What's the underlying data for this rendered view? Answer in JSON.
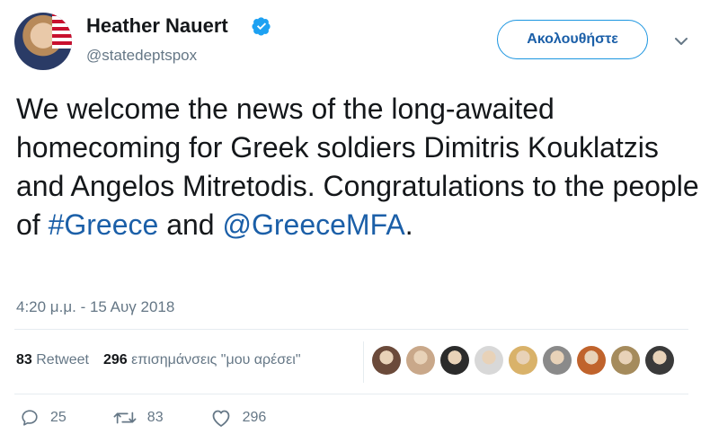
{
  "author": {
    "name": "Heather Nauert",
    "handle": "@statedeptspox",
    "verified": true
  },
  "follow_button": {
    "label": "Ακολουθήστε"
  },
  "tweet": {
    "text_parts": [
      "We welcome the news of the long-awaited homecoming for Greek soldiers Dimitris Kouklatzis and Angelos Mitretodis. Congratulations to the people of ",
      "#Greece",
      " and ",
      "@GreeceMFA",
      "."
    ],
    "timestamp": "4:20 μ.μ. - 15 Αυγ 2018"
  },
  "stats": {
    "retweets_count": "83",
    "retweets_label": "Retweet",
    "likes_count": "296",
    "likes_label": "επισημάνσεις \"μου αρέσει\""
  },
  "likers": [
    {
      "color": "#6b4a3a"
    },
    {
      "color": "#c9a88a"
    },
    {
      "color": "#2b2b2b"
    },
    {
      "color": "#d8d8d8"
    },
    {
      "color": "#d9b26a"
    },
    {
      "color": "#8a8a8a"
    },
    {
      "color": "#c0632c"
    },
    {
      "color": "#a58b5c"
    },
    {
      "color": "#3a3a3a"
    }
  ],
  "actions": {
    "replies": "25",
    "retweets": "83",
    "likes": "296"
  },
  "colors": {
    "accent": "#1b95e0",
    "link": "#1b5fa8",
    "muted": "#657786"
  }
}
